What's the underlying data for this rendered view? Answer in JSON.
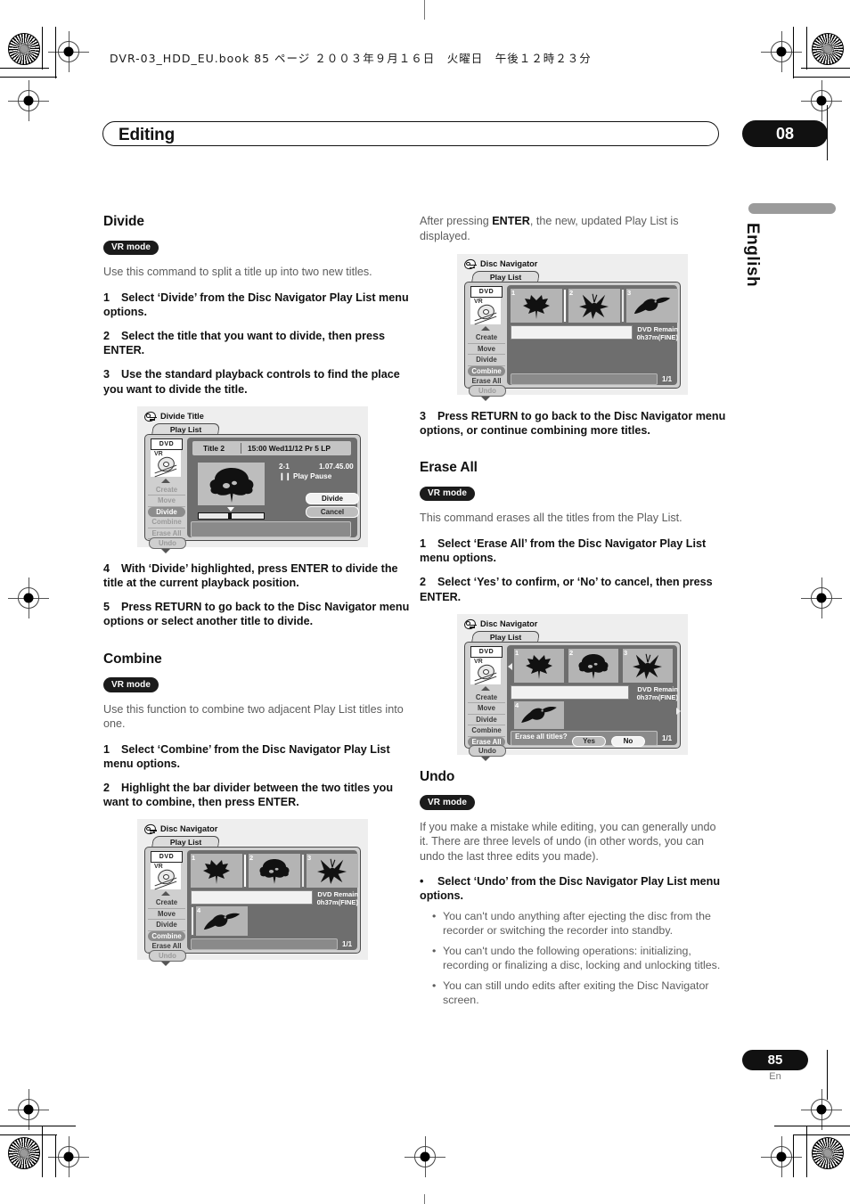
{
  "header": {
    "book_line": "DVR-03_HDD_EU.book 85 ページ ２００３年９月１６日　火曜日　午後１２時２３分"
  },
  "chapter": {
    "title": "Editing",
    "number": "08"
  },
  "margin": {
    "language": "English",
    "page_number": "85",
    "page_suffix": "En"
  },
  "left_column": {
    "divide": {
      "heading": "Divide",
      "badge": "VR mode",
      "intro": "Use this command to split a title up into two new titles.",
      "steps": [
        {
          "n": "1",
          "text": "Select ‘Divide’ from the Disc Navigator Play List menu options."
        },
        {
          "n": "2",
          "text": "Select the title that you want to divide, then press ENTER."
        },
        {
          "n": "3",
          "text": "Use the standard playback controls to find the place you want to divide the title."
        },
        {
          "n": "4",
          "text": "With ‘Divide’ highlighted, press ENTER to divide the title at the current playback position."
        },
        {
          "n": "5",
          "text": "Press RETURN to go back to the Disc Navigator menu options or select another title to divide."
        }
      ]
    },
    "combine": {
      "heading": "Combine",
      "badge": "VR mode",
      "intro": "Use this function to combine two adjacent Play List titles into one.",
      "steps": [
        {
          "n": "1",
          "text": "Select ‘Combine’ from the Disc Navigator Play List menu options."
        },
        {
          "n": "2",
          "text": "Highlight the bar divider between the two titles you want to combine, then press ENTER."
        }
      ]
    }
  },
  "right_column": {
    "intro_before": "After pressing ",
    "intro_bold": "ENTER",
    "intro_after": ", the new, updated Play List is displayed.",
    "combine_step3": {
      "n": "3",
      "text": "Press RETURN to go back to the Disc Navigator menu options, or continue combining more titles."
    },
    "erase_all": {
      "heading": "Erase All",
      "badge": "VR mode",
      "intro": "This command erases all the titles from the Play List.",
      "steps": [
        {
          "n": "1",
          "text": "Select ‘Erase All’ from the Disc Navigator Play List menu options."
        },
        {
          "n": "2",
          "text": "Select ‘Yes’ to confirm, or ‘No’ to cancel, then press ENTER."
        }
      ]
    },
    "undo": {
      "heading": "Undo",
      "badge": "VR mode",
      "intro": "If you make a mistake while editing, you can generally undo it. There are three levels of undo (in other words, you can undo the last three edits you made).",
      "bullet": {
        "n": "•",
        "text": "Select ‘Undo’ from the Disc Navigator Play List menu options."
      },
      "sub_bullets": [
        "You can't undo anything after ejecting the disc from the recorder or switching the recorder into standby.",
        "You can't undo the following operations: initializing, recording or finalizing a disc, locking and unlocking titles.",
        "You can still undo edits after exiting the Disc Navigator screen."
      ]
    }
  },
  "figures": {
    "divide_title": {
      "window_title": "Divide Title",
      "tab": "Play List",
      "disc_type": "DVD",
      "disc_mode": "VR",
      "menu": [
        "Create",
        "Move",
        "Divide",
        "Combine",
        "Erase All"
      ],
      "menu_selected": "Divide",
      "undo_label": "Undo",
      "title_name": "Title 2",
      "title_info": "15:00 Wed11/12  Pr 5   LP",
      "chapter_ref": "2-1",
      "timecode": "1.07.45.00",
      "play_state": "Play Pause",
      "buttons": [
        "Divide",
        "Cancel"
      ],
      "button_selected": "Divide"
    },
    "combine_nav": {
      "window_title": "Disc Navigator",
      "tab": "Play List",
      "disc_type": "DVD",
      "disc_mode": "VR",
      "menu": [
        "Create",
        "Move",
        "Divide",
        "Combine",
        "Erase All"
      ],
      "menu_selected": "Combine",
      "undo_label": "Undo",
      "remain_label": "DVD Remain",
      "remain_value": "0h37m(FINE)",
      "page_count": "1/1",
      "thumbnails": [
        {
          "num": "1",
          "art": "maple-leaf"
        },
        {
          "num": "2",
          "art": "tree"
        },
        {
          "num": "3",
          "art": "flower"
        },
        {
          "num": "4",
          "art": "toucan"
        }
      ]
    },
    "combined_result_nav": {
      "window_title": "Disc Navigator",
      "tab": "Play List",
      "disc_type": "DVD",
      "disc_mode": "VR",
      "menu": [
        "Create",
        "Move",
        "Divide",
        "Combine",
        "Erase All"
      ],
      "menu_selected": "Combine",
      "undo_label": "Undo",
      "remain_label": "DVD Remain",
      "remain_value": "0h37m(FINE)",
      "page_count": "1/1",
      "thumbnails": [
        {
          "num": "1",
          "art": "maple-leaf"
        },
        {
          "num": "2",
          "art": "flower"
        },
        {
          "num": "3",
          "art": "toucan"
        }
      ]
    },
    "erase_all_nav": {
      "window_title": "Disc Navigator",
      "tab": "Play List",
      "disc_type": "DVD",
      "disc_mode": "VR",
      "menu": [
        "Create",
        "Move",
        "Divide",
        "Combine",
        "Erase All"
      ],
      "menu_selected": "Erase All",
      "undo_label": "Undo",
      "remain_label": "DVD Remain",
      "remain_value": "0h37m(FINE)",
      "page_count": "1/1",
      "confirm_prompt": "Erase all titles?",
      "confirm_yes": "Yes",
      "confirm_no": "No",
      "confirm_selected": "No",
      "thumbnails": [
        {
          "num": "1",
          "art": "maple-leaf"
        },
        {
          "num": "2",
          "art": "tree"
        },
        {
          "num": "3",
          "art": "flower"
        },
        {
          "num": "4",
          "art": "toucan"
        }
      ]
    }
  }
}
